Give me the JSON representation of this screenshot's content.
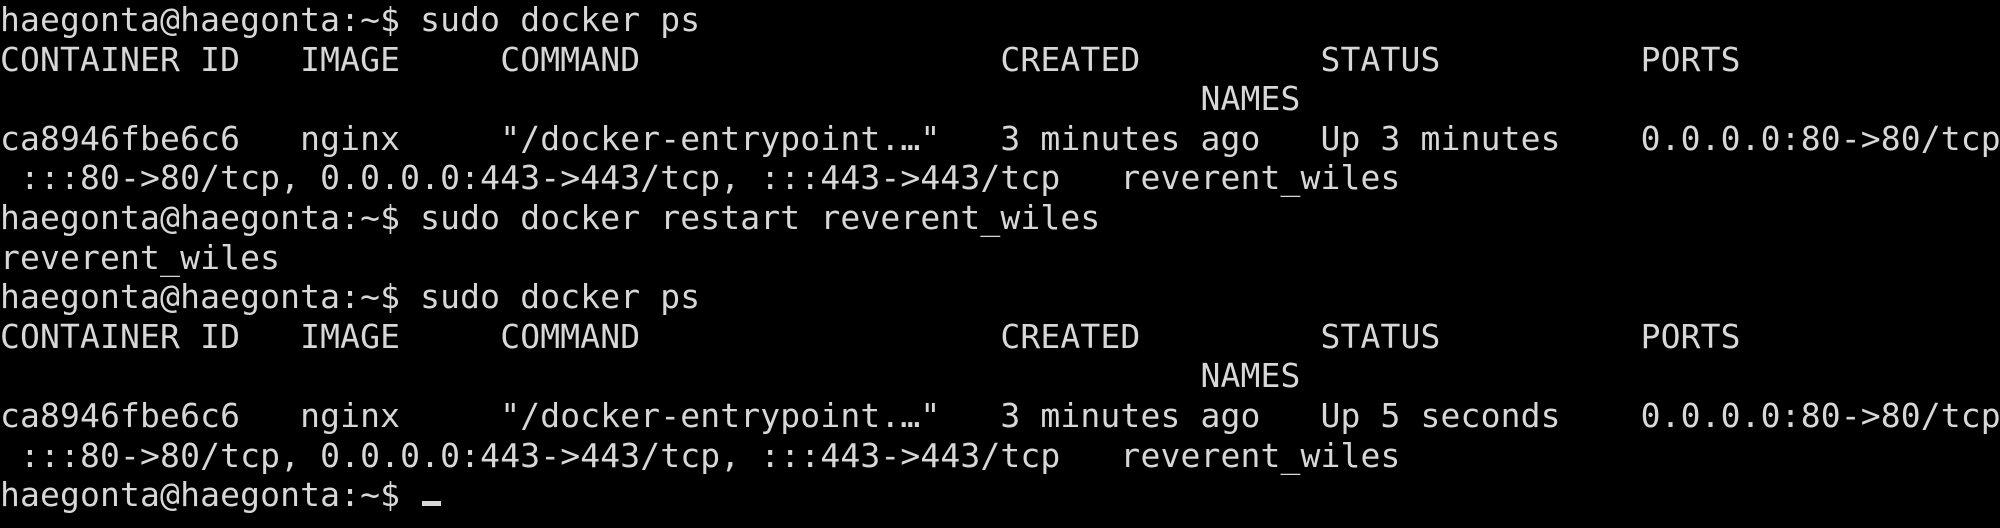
{
  "terminal": {
    "lines": [
      "haegonta@haegonta:~$ sudo docker ps",
      "CONTAINER ID   IMAGE     COMMAND                  CREATED         STATUS          PORTS",
      "                                                            NAMES",
      "ca8946fbe6c6   nginx     \"/docker-entrypoint.…\"   3 minutes ago   Up 3 minutes    0.0.0.0:80->80/tcp,",
      " :::80->80/tcp, 0.0.0.0:443->443/tcp, :::443->443/tcp   reverent_wiles",
      "haegonta@haegonta:~$ sudo docker restart reverent_wiles",
      "reverent_wiles",
      "haegonta@haegonta:~$ sudo docker ps",
      "CONTAINER ID   IMAGE     COMMAND                  CREATED         STATUS          PORTS",
      "                                                            NAMES",
      "ca8946fbe6c6   nginx     \"/docker-entrypoint.…\"   3 minutes ago   Up 5 seconds    0.0.0.0:80->80/tcp,",
      " :::80->80/tcp, 0.0.0.0:443->443/tcp, :::443->443/tcp   reverent_wiles"
    ],
    "prompt": "haegonta@haegonta:~$ ",
    "colors": {
      "background": "#000000",
      "foreground": "#d7d7d7"
    }
  }
}
